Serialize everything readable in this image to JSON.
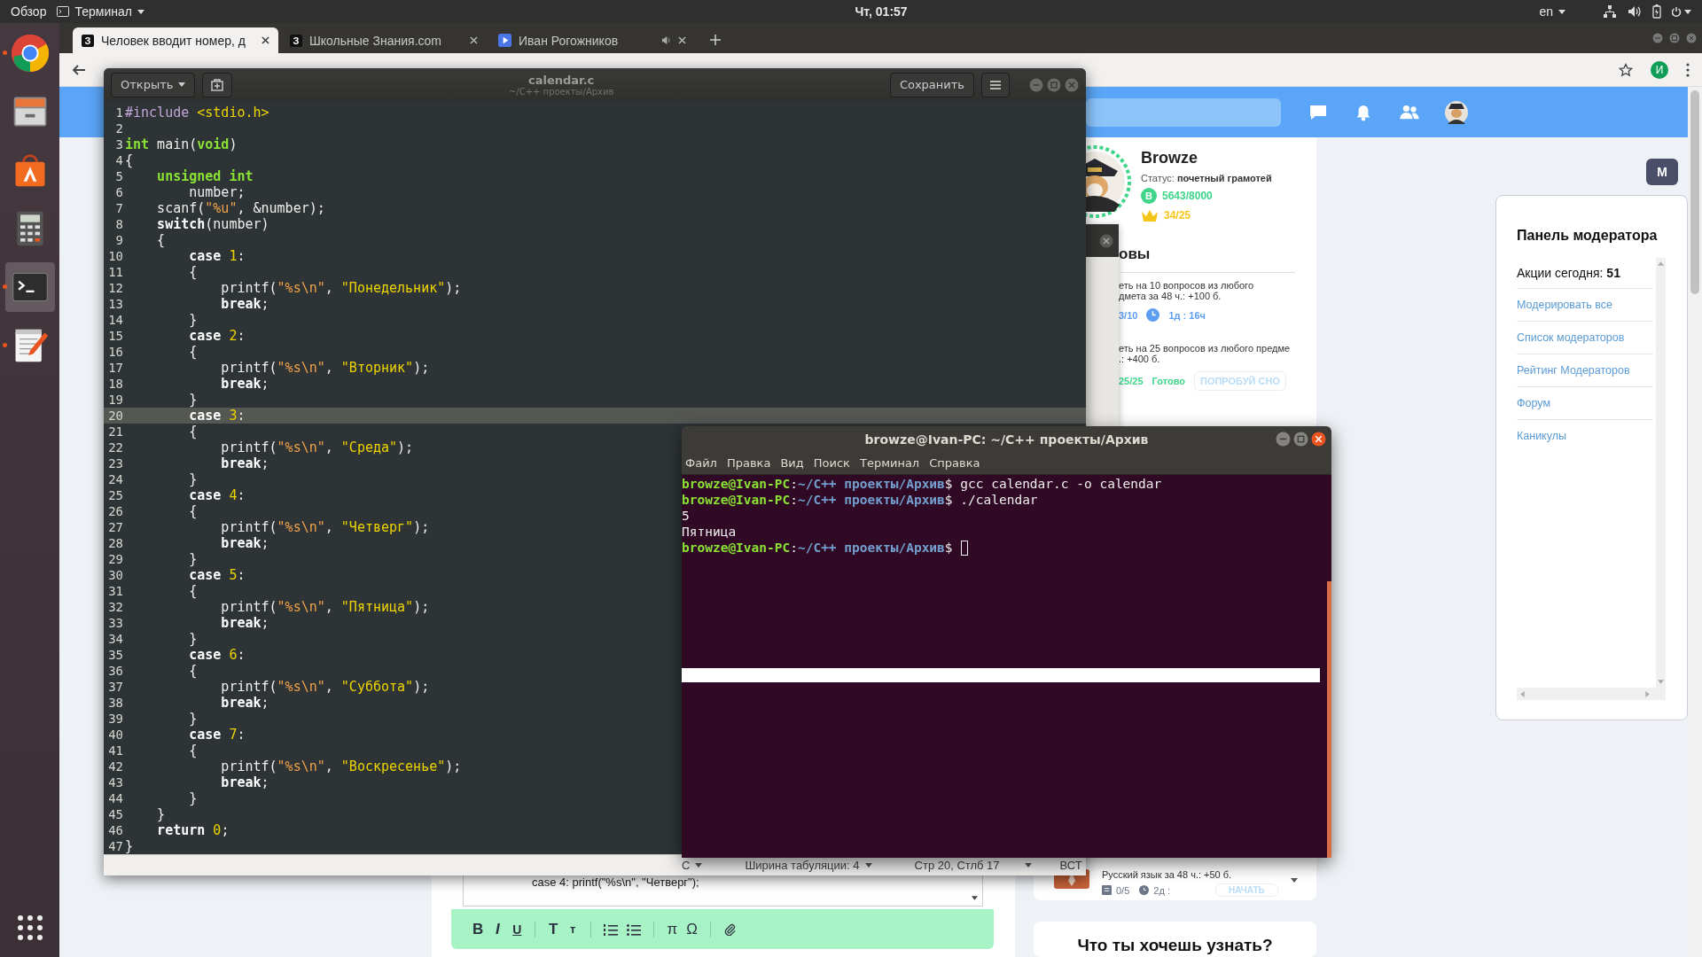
{
  "top_bar": {
    "activities": "Обзор",
    "app_menu": "Терминал",
    "clock": "Чт, 01:57",
    "language": "en"
  },
  "dock": {
    "items": [
      {
        "kind": "chrome",
        "running": true,
        "selected": false
      },
      {
        "kind": "files",
        "running": false,
        "selected": false
      },
      {
        "kind": "store",
        "running": false,
        "selected": false
      },
      {
        "kind": "calculator",
        "running": false,
        "selected": false
      },
      {
        "kind": "terminal",
        "running": true,
        "selected": true
      },
      {
        "kind": "editor",
        "running": true,
        "selected": false
      }
    ]
  },
  "browser": {
    "tabs": [
      {
        "kind": "site",
        "favicon_text": "З",
        "title": "Человек вводит номер, д",
        "selected": true,
        "audio": false
      },
      {
        "kind": "site",
        "favicon_text": "З",
        "title": "Школьные Знания.com",
        "selected": false,
        "audio": false
      },
      {
        "kind": "video",
        "title": "Иван Рогожников",
        "selected": false,
        "audio": true
      }
    ],
    "profile_initial": "И",
    "page": {
      "profile": {
        "name": "Browze",
        "status": "Статус: **почетный грамотей**",
        "points_badge": "B",
        "points": "5643/8000",
        "crowns": "34/25"
      },
      "tasks_heading": "овы",
      "tasks": [
        {
          "kind": "running",
          "text": "еть на 10 вопросов из любого\nдмета за 48 ч.: +100 б.",
          "progress": "3/10",
          "timer": "1д : 16ч"
        },
        {
          "kind": "done",
          "text": "еть на 25 вопросов из любого предме\n.: +400 б.",
          "progress": "25/25",
          "status": "Готово",
          "action": "ПОПРОБУЙ СНО"
        }
      ],
      "task_card": {
        "kind": "new",
        "text": "Русский язык за 48 ч.: +50 б.",
        "progress": "0/5",
        "timer": "2д :",
        "action": "НАЧАТЬ"
      },
      "ask_card": {
        "title": "Что ты хочешь узнать?"
      },
      "answer_editor": {
        "text": "case 4: printf(\"%s\\n\", \"Четверг\");",
        "tool_groups": [
          [
            {
              "kind": "bold",
              "label": "B"
            },
            {
              "kind": "italic",
              "label": "I"
            },
            {
              "kind": "underline",
              "label": "U"
            }
          ],
          [
            {
              "kind": "large",
              "label": "T"
            },
            {
              "kind": "small",
              "label": "т"
            }
          ],
          [
            {
              "kind": "ordered-list"
            },
            {
              "kind": "bullet-list"
            }
          ],
          [
            {
              "kind": "symbol",
              "label": "π"
            },
            {
              "kind": "symbol",
              "label": "Ω"
            }
          ],
          [
            {
              "kind": "attach"
            }
          ]
        ]
      },
      "moderator": {
        "button": "M",
        "title": "Панель модератора",
        "actions_today": "Акции сегодня: **51**",
        "links": [
          "Модерировать все",
          "Список модераторов",
          "Рейтинг Модераторов",
          "Форум",
          "Каникулы"
        ]
      }
    }
  },
  "editor": {
    "open": "Открыть",
    "title": "calendar.c",
    "subtitle": "~/C++ проекты/Архив",
    "save": "Сохранить",
    "lines": [
      {
        "number": "1",
        "current": false,
        "tokens": [
          {
            "kind": "pre",
            "text": "#include "
          },
          {
            "kind": "inc",
            "text": "<stdio.h>"
          }
        ]
      },
      {
        "number": "2",
        "current": false
      },
      {
        "number": "3",
        "current": false,
        "tokens": [
          {
            "kind": "type",
            "text": "int"
          },
          {
            "kind": "plain",
            "text": " main("
          },
          {
            "kind": "type",
            "text": "void"
          },
          {
            "kind": "plain",
            "text": ")"
          }
        ]
      },
      {
        "number": "4",
        "current": false,
        "tokens": [
          {
            "kind": "plain",
            "text": "{"
          }
        ]
      },
      {
        "number": "5",
        "current": false,
        "tokens": [
          {
            "kind": "type",
            "text": "    unsigned int"
          }
        ]
      },
      {
        "number": "6",
        "current": false,
        "tokens": [
          {
            "kind": "plain",
            "text": "        number;"
          }
        ]
      },
      {
        "number": "7",
        "current": false,
        "tokens": [
          {
            "kind": "plain",
            "text": "    scanf("
          },
          {
            "kind": "fmt",
            "text": "\"%u\""
          },
          {
            "kind": "plain",
            "text": ", &number);"
          }
        ]
      },
      {
        "number": "8",
        "current": false,
        "tokens": [
          {
            "kind": "kw",
            "text": "    switch"
          },
          {
            "kind": "plain",
            "text": "(number)"
          }
        ]
      },
      {
        "number": "9",
        "current": false,
        "tokens": [
          {
            "kind": "plain",
            "text": "    {"
          }
        ]
      },
      {
        "number": "10",
        "current": false,
        "tokens": [
          {
            "kind": "kw",
            "text": "        case"
          },
          {
            "kind": "num",
            "text": " 1"
          },
          {
            "kind": "plain",
            "text": ":"
          }
        ]
      },
      {
        "number": "11",
        "current": false,
        "tokens": [
          {
            "kind": "plain",
            "text": "        {"
          }
        ]
      },
      {
        "number": "12",
        "current": false,
        "tokens": [
          {
            "kind": "plain",
            "text": "            printf("
          },
          {
            "kind": "fmt",
            "text": "\"%s\\n\""
          },
          {
            "kind": "plain",
            "text": ", "
          },
          {
            "kind": "str",
            "text": "\"Понедельник\""
          },
          {
            "kind": "plain",
            "text": ");"
          }
        ]
      },
      {
        "number": "13",
        "current": false,
        "tokens": [
          {
            "kind": "kw",
            "text": "            break"
          },
          {
            "kind": "plain",
            "text": ";"
          }
        ]
      },
      {
        "number": "14",
        "current": false,
        "tokens": [
          {
            "kind": "plain",
            "text": "        }"
          }
        ]
      },
      {
        "number": "15",
        "current": false,
        "tokens": [
          {
            "kind": "kw",
            "text": "        case"
          },
          {
            "kind": "num",
            "text": " 2"
          },
          {
            "kind": "plain",
            "text": ":"
          }
        ]
      },
      {
        "number": "16",
        "current": false,
        "tokens": [
          {
            "kind": "plain",
            "text": "        {"
          }
        ]
      },
      {
        "number": "17",
        "current": false,
        "tokens": [
          {
            "kind": "plain",
            "text": "            printf("
          },
          {
            "kind": "fmt",
            "text": "\"%s\\n\""
          },
          {
            "kind": "plain",
            "text": ", "
          },
          {
            "kind": "str",
            "text": "\"Вторник\""
          },
          {
            "kind": "plain",
            "text": ");"
          }
        ]
      },
      {
        "number": "18",
        "current": false,
        "tokens": [
          {
            "kind": "kw",
            "text": "            break"
          },
          {
            "kind": "plain",
            "text": ";"
          }
        ]
      },
      {
        "number": "19",
        "current": false,
        "tokens": [
          {
            "kind": "plain",
            "text": "        }"
          }
        ]
      },
      {
        "number": "20",
        "current": true,
        "tokens": [
          {
            "kind": "kw",
            "text": "        case"
          },
          {
            "kind": "num",
            "text": " 3"
          },
          {
            "kind": "plain",
            "text": ":"
          }
        ]
      },
      {
        "number": "21",
        "current": false,
        "tokens": [
          {
            "kind": "plain",
            "text": "        {"
          }
        ]
      },
      {
        "number": "22",
        "current": false,
        "tokens": [
          {
            "kind": "plain",
            "text": "            printf("
          },
          {
            "kind": "fmt",
            "text": "\"%s\\n\""
          },
          {
            "kind": "plain",
            "text": ", "
          },
          {
            "kind": "str",
            "text": "\"Среда\""
          },
          {
            "kind": "plain",
            "text": ");"
          }
        ]
      },
      {
        "number": "23",
        "current": false,
        "tokens": [
          {
            "kind": "kw",
            "text": "            break"
          },
          {
            "kind": "plain",
            "text": ";"
          }
        ]
      },
      {
        "number": "24",
        "current": false,
        "tokens": [
          {
            "kind": "plain",
            "text": "        }"
          }
        ]
      },
      {
        "number": "25",
        "current": false,
        "tokens": [
          {
            "kind": "kw",
            "text": "        case"
          },
          {
            "kind": "num",
            "text": " 4"
          },
          {
            "kind": "plain",
            "text": ":"
          }
        ]
      },
      {
        "number": "26",
        "current": false,
        "tokens": [
          {
            "kind": "plain",
            "text": "        {"
          }
        ]
      },
      {
        "number": "27",
        "current": false,
        "tokens": [
          {
            "kind": "plain",
            "text": "            printf("
          },
          {
            "kind": "fmt",
            "text": "\"%s\\n\""
          },
          {
            "kind": "plain",
            "text": ", "
          },
          {
            "kind": "str",
            "text": "\"Четверг\""
          },
          {
            "kind": "plain",
            "text": ");"
          }
        ]
      },
      {
        "number": "28",
        "current": false,
        "tokens": [
          {
            "kind": "kw",
            "text": "            break"
          },
          {
            "kind": "plain",
            "text": ";"
          }
        ]
      },
      {
        "number": "29",
        "current": false,
        "tokens": [
          {
            "kind": "plain",
            "text": "        }"
          }
        ]
      },
      {
        "number": "30",
        "current": false,
        "tokens": [
          {
            "kind": "kw",
            "text": "        case"
          },
          {
            "kind": "num",
            "text": " 5"
          },
          {
            "kind": "plain",
            "text": ":"
          }
        ]
      },
      {
        "number": "31",
        "current": false,
        "tokens": [
          {
            "kind": "plain",
            "text": "        {"
          }
        ]
      },
      {
        "number": "32",
        "current": false,
        "tokens": [
          {
            "kind": "plain",
            "text": "            printf("
          },
          {
            "kind": "fmt",
            "text": "\"%s\\n\""
          },
          {
            "kind": "plain",
            "text": ", "
          },
          {
            "kind": "str",
            "text": "\"Пятница\""
          },
          {
            "kind": "plain",
            "text": ");"
          }
        ]
      },
      {
        "number": "33",
        "current": false,
        "tokens": [
          {
            "kind": "kw",
            "text": "            break"
          },
          {
            "kind": "plain",
            "text": ";"
          }
        ]
      },
      {
        "number": "34",
        "current": false,
        "tokens": [
          {
            "kind": "plain",
            "text": "        }"
          }
        ]
      },
      {
        "number": "35",
        "current": false,
        "tokens": [
          {
            "kind": "kw",
            "text": "        case"
          },
          {
            "kind": "num",
            "text": " 6"
          },
          {
            "kind": "plain",
            "text": ":"
          }
        ]
      },
      {
        "number": "36",
        "current": false,
        "tokens": [
          {
            "kind": "plain",
            "text": "        {"
          }
        ]
      },
      {
        "number": "37",
        "current": false,
        "tokens": [
          {
            "kind": "plain",
            "text": "            printf("
          },
          {
            "kind": "fmt",
            "text": "\"%s\\n\""
          },
          {
            "kind": "plain",
            "text": ", "
          },
          {
            "kind": "str",
            "text": "\"Суббота\""
          },
          {
            "kind": "plain",
            "text": ");"
          }
        ]
      },
      {
        "number": "38",
        "current": false,
        "tokens": [
          {
            "kind": "kw",
            "text": "            break"
          },
          {
            "kind": "plain",
            "text": ";"
          }
        ]
      },
      {
        "number": "39",
        "current": false,
        "tokens": [
          {
            "kind": "plain",
            "text": "        }"
          }
        ]
      },
      {
        "number": "40",
        "current": false,
        "tokens": [
          {
            "kind": "kw",
            "text": "        case"
          },
          {
            "kind": "num",
            "text": " 7"
          },
          {
            "kind": "plain",
            "text": ":"
          }
        ]
      },
      {
        "number": "41",
        "current": false,
        "tokens": [
          {
            "kind": "plain",
            "text": "        {"
          }
        ]
      },
      {
        "number": "42",
        "current": false,
        "tokens": [
          {
            "kind": "plain",
            "text": "            printf("
          },
          {
            "kind": "fmt",
            "text": "\"%s\\n\""
          },
          {
            "kind": "plain",
            "text": ", "
          },
          {
            "kind": "str",
            "text": "\"Воскресенье\""
          },
          {
            "kind": "plain",
            "text": ");"
          }
        ]
      },
      {
        "number": "43",
        "current": false,
        "tokens": [
          {
            "kind": "kw",
            "text": "            break"
          },
          {
            "kind": "plain",
            "text": ";"
          }
        ]
      },
      {
        "number": "44",
        "current": false,
        "tokens": [
          {
            "kind": "plain",
            "text": "        }"
          }
        ]
      },
      {
        "number": "45",
        "current": false,
        "tokens": [
          {
            "kind": "plain",
            "text": "    }"
          }
        ]
      },
      {
        "number": "46",
        "current": false,
        "tokens": [
          {
            "kind": "kw",
            "text": "    return"
          },
          {
            "kind": "num",
            "text": " 0"
          },
          {
            "kind": "plain",
            "text": ";"
          }
        ]
      },
      {
        "number": "47",
        "current": false,
        "tokens": [
          {
            "kind": "plain",
            "text": "}"
          }
        ]
      }
    ],
    "status": {
      "language": "C",
      "tab_width": "Ширина табуляции: 4",
      "position": "Стр 20, Стлб 17",
      "mode": "ВСТ"
    }
  },
  "terminal": {
    "title": "browze@Ivan-PC: ~/C++ проекты/Архив",
    "menu": [
      "Файл",
      "Правка",
      "Вид",
      "Поиск",
      "Терминал",
      "Справка"
    ],
    "lines": [
      {
        "cursor": false,
        "tokens": [
          {
            "kind": "user",
            "text": "browze@Ivan-PC"
          },
          {
            "kind": "plain",
            "text": ":"
          },
          {
            "kind": "path",
            "text": "~/C++ проекты/Архив"
          },
          {
            "kind": "plain",
            "text": "$ gcc calendar.c -o calendar"
          }
        ]
      },
      {
        "cursor": false,
        "tokens": [
          {
            "kind": "user",
            "text": "browze@Ivan-PC"
          },
          {
            "kind": "plain",
            "text": ":"
          },
          {
            "kind": "path",
            "text": "~/C++ проекты/Архив"
          },
          {
            "kind": "plain",
            "text": "$ ./calendar"
          }
        ]
      },
      {
        "cursor": false,
        "tokens": [
          {
            "kind": "plain",
            "text": "5"
          }
        ]
      },
      {
        "cursor": false,
        "tokens": [
          {
            "kind": "plain",
            "text": "Пятница"
          }
        ]
      },
      {
        "cursor": true,
        "tokens": [
          {
            "kind": "user",
            "text": "browze@Ivan-PC"
          },
          {
            "kind": "plain",
            "text": ":"
          },
          {
            "kind": "path",
            "text": "~/C++ проекты/Архив"
          },
          {
            "kind": "plain",
            "text": "$"
          }
        ]
      }
    ]
  }
}
